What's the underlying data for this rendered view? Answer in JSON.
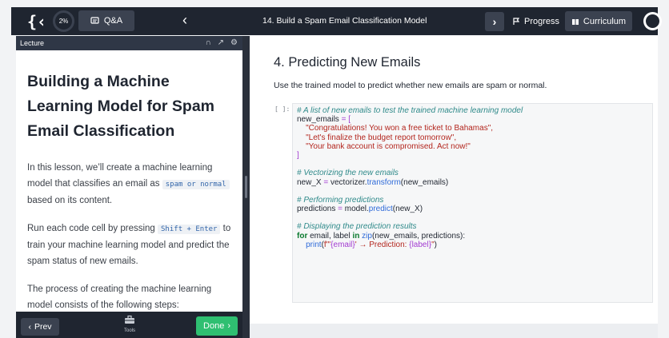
{
  "topbar": {
    "progress": "2%",
    "qa_label": "Q&A",
    "lesson_title": "14. Build a Spam Email Classification Model",
    "progress_label": "Progress",
    "curriculum_label": "Curriculum"
  },
  "lecture": {
    "header": "Lecture",
    "title": "Building a Machine Learning Model for Spam Email Classification",
    "p1_a": "In this lesson, we’ll create a machine learning model that classifies an email as ",
    "p1_code": "spam or normal",
    "p1_b": " based on its content.",
    "p2_a": "Run each code cell by pressing ",
    "p2_code": "Shift + Enter",
    "p2_b": " to train your machine learning model and predict the spam status of new emails.",
    "p3": "The process of creating the machine learning model consists of the following steps:"
  },
  "footer": {
    "prev_label": "Prev",
    "tools_label": "Tools",
    "done_label": "Done"
  },
  "notebook": {
    "heading": "4. Predicting New Emails",
    "description": "Use the trained model to predict whether new emails are spam or normal.",
    "cell_prompt": "[ ]:",
    "code": {
      "comment1": "# A list of new emails to test the trained machine learning model",
      "var1": "new_emails",
      "eq": "=",
      "open_bracket": "[",
      "str1": "\"Congratulations! You won a free ticket to Bahamas\",",
      "str2": "\"Let's finalize the budget report tomorrow\",",
      "str3": "\"Your bank account is compromised. Act now!\"",
      "close_bracket": "]",
      "comment2": "# Vectorizing the new emails",
      "var2": "new_X",
      "obj1": "vectorizer.",
      "fn1": "transform",
      "args1": "(new_emails)",
      "comment3": "# Performing predictions",
      "var3": "predictions",
      "obj2": "model.",
      "fn2": "predict",
      "args2": "(new_X)",
      "comment4": "# Displaying the prediction results",
      "kw_for": "for",
      "loop_vars": " email, label ",
      "kw_in": "in",
      "fn3": "zip",
      "args3": "(new_emails, predictions):",
      "print_fn": "print",
      "print_open": "(",
      "fstr1": "f\"'",
      "fvar1": "{email}",
      "fstr2": "' → Prediction: ",
      "fvar2": "{label}",
      "fstr3": "\"",
      "print_close": ")"
    }
  },
  "colors": {
    "topbar_bg": "#1f2530",
    "button_bg": "#3b4250",
    "done_green": "#2fbf71"
  }
}
